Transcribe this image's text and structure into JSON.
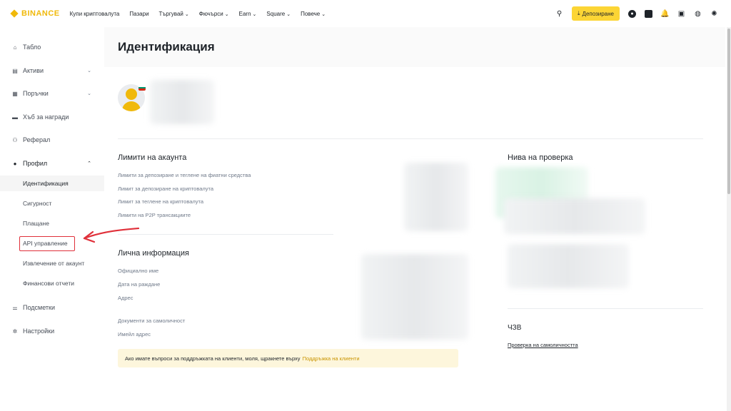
{
  "brand": {
    "name": "BINANCE",
    "accent": "#f0b90b"
  },
  "nav": {
    "items": [
      {
        "label": "Купи криптовалута",
        "has_dropdown": false
      },
      {
        "label": "Пазари",
        "has_dropdown": false
      },
      {
        "label": "Търгувай",
        "has_dropdown": true
      },
      {
        "label": "Фючърси",
        "has_dropdown": true
      },
      {
        "label": "Earn",
        "has_dropdown": true
      },
      {
        "label": "Square",
        "has_dropdown": true
      },
      {
        "label": "Повече",
        "has_dropdown": true
      }
    ],
    "deposit_label": "Депозиране",
    "deposit_icon": "download-icon",
    "right_icons": [
      "search-icon",
      "user-icon",
      "wallet-icon",
      "bell-icon",
      "download-app-icon",
      "globe-icon",
      "theme-icon"
    ]
  },
  "sidebar": {
    "items": [
      {
        "label": "Табло",
        "icon": "home-icon"
      },
      {
        "label": "Активи",
        "icon": "wallet-icon",
        "expandable": true
      },
      {
        "label": "Поръчки",
        "icon": "orders-icon",
        "expandable": true
      },
      {
        "label": "Хъб за награди",
        "icon": "ticket-icon"
      },
      {
        "label": "Реферал",
        "icon": "user-plus-icon"
      },
      {
        "label": "Профил",
        "icon": "user-icon",
        "expanded": true
      }
    ],
    "profile_sub": [
      {
        "label": "Идентификация",
        "active": true
      },
      {
        "label": "Сигурност"
      },
      {
        "label": "Плащане"
      },
      {
        "label": "API управление"
      },
      {
        "label": "Извлечение от акаунт"
      },
      {
        "label": "Финансови отчети"
      }
    ],
    "bottom_items": [
      {
        "label": "Подсметки",
        "icon": "subaccount-icon"
      },
      {
        "label": "Настройки",
        "icon": "settings-icon"
      }
    ]
  },
  "main": {
    "title": "Идентификация",
    "limits": {
      "heading": "Лимити на акаунта",
      "items": [
        "Лимити за депозиране и теглене на фиатни средства",
        "Лимит за депозиране на криптовалута",
        "Лимит за теглене на криптовалута",
        "Лимити на P2P трансакциите"
      ]
    },
    "personal": {
      "heading": "Лична информация",
      "items": [
        "Официално име",
        "Дата на раждане",
        "Адрес",
        "Документи за самоличност",
        "Имейл адрес"
      ]
    },
    "verification": {
      "heading": "Нива на проверка"
    },
    "faq": {
      "heading": "ЧЗВ",
      "link": "Проверка на самоличността"
    },
    "notice": {
      "text": "Ако имате въпроси за поддръжката на клиенти, моля, щракнете върху",
      "link": "Поддръжка на клиенти"
    }
  }
}
